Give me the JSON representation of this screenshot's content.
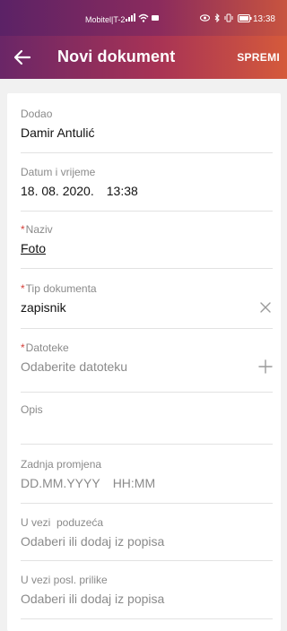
{
  "status_bar": {
    "carrier": "Mobitel|T-2",
    "time": "13:38",
    "icons": [
      "signal-icon",
      "wifi-icon",
      "camera-icon",
      "eye-icon",
      "bluetooth-icon",
      "vibrate-icon",
      "battery-icon"
    ]
  },
  "app_bar": {
    "back_icon": "arrow-left-icon",
    "title": "Novi dokument",
    "save_label": "SPREMI"
  },
  "colors": {
    "gradient_start": "#5b2266",
    "gradient_end": "#d55a3b",
    "required_marker": "#d5403a"
  },
  "form": {
    "added_by": {
      "label": "Dodao",
      "value": "Damir Antulić"
    },
    "datetime": {
      "label": "Datum i vrijeme",
      "date": "18. 08. 2020.",
      "time": "13:38"
    },
    "name": {
      "required": "*",
      "label": "Naziv",
      "value": "Foto"
    },
    "doc_type": {
      "required": "*",
      "label": "Tip dokumenta",
      "value": "zapisnik",
      "action_icon": "clear-icon"
    },
    "files": {
      "required": "*",
      "label": "Datoteke",
      "placeholder": "Odaberite datoteku",
      "action_icon": "plus-icon"
    },
    "description": {
      "label": "Opis",
      "value": ""
    },
    "last_change": {
      "label": "Zadnja promjena",
      "date_placeholder": "DD.MM.YYYY",
      "time_placeholder": "HH:MM"
    },
    "company": {
      "label": "U vezi  poduzeća",
      "placeholder": "Odaberi ili dodaj iz popisa"
    },
    "opportunity": {
      "label": "U vezi posl. prilike",
      "placeholder": "Odaberi ili dodaj iz popisa"
    }
  }
}
